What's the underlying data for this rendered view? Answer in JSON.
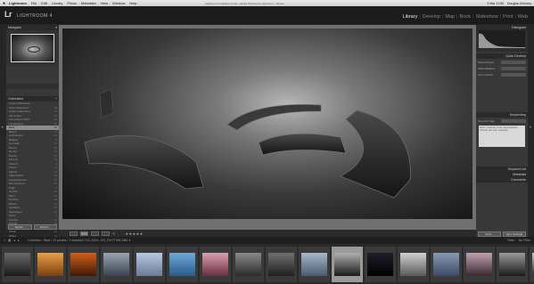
{
  "menubar": {
    "apple": "",
    "items": [
      "Lightroom",
      "File",
      "Edit",
      "Library",
      "Photo",
      "Metadata",
      "View",
      "Window",
      "Help"
    ],
    "window_title": "Lightroom 4 Catalog 4.lrcat - Adobe Photoshop Lightroom - Library",
    "status": [
      "5 Mar 11:55",
      "Douglas Chrinery"
    ]
  },
  "identity": {
    "logo": "Lr",
    "name": "LIGHTROOM 4"
  },
  "modules": [
    "Library",
    "Develop",
    "Map",
    "Book",
    "Slideshow",
    "Print",
    "Web"
  ],
  "active_module": "Library",
  "left_panel": {
    "navigator_label": "Navigator",
    "collections_label": "Collections",
    "collections": [
      {
        "name": "Smart Collections",
        "count": ""
      },
      {
        "name": "Client Selections",
        "count": "18"
      },
      {
        "name": "Colour Collections",
        "count": "24"
      },
      {
        "name": "Jan to Dec",
        "count": "32"
      },
      {
        "name": "LR Lessons 2012",
        "count": "16"
      },
      {
        "name": "Landscapes",
        "count": "45"
      },
      {
        "name": "Best",
        "count": "22"
      },
      {
        "name": "Beach",
        "count": "14"
      },
      {
        "name": "Architecture",
        "count": "31"
      },
      {
        "name": "Bridges",
        "count": "9"
      },
      {
        "name": "Cornwall",
        "count": "27"
      },
      {
        "name": "Devon",
        "count": "12"
      },
      {
        "name": "Dorset",
        "count": "19"
      },
      {
        "name": "Family",
        "count": "40"
      },
      {
        "name": "Fine Art",
        "count": "33"
      },
      {
        "name": "Flowers",
        "count": "8"
      },
      {
        "name": "Forest",
        "count": "11"
      },
      {
        "name": "Ireland",
        "count": "17"
      },
      {
        "name": "Lake District",
        "count": "23"
      },
      {
        "name": "Long Exposure",
        "count": "52"
      },
      {
        "name": "Monochrome",
        "count": "38"
      },
      {
        "name": "Night",
        "count": "6"
      },
      {
        "name": "Norfolk",
        "count": "15"
      },
      {
        "name": "Piers",
        "count": "21"
      },
      {
        "name": "Portfolio",
        "count": "28"
      },
      {
        "name": "Rivers",
        "count": "10"
      },
      {
        "name": "Scotland",
        "count": "26"
      },
      {
        "name": "Seascapes",
        "count": "44"
      },
      {
        "name": "Snow",
        "count": "7"
      },
      {
        "name": "Sunrise",
        "count": "13"
      },
      {
        "name": "Sunset",
        "count": "20"
      },
      {
        "name": "Trees",
        "count": "9"
      },
      {
        "name": "Urban",
        "count": "16"
      },
      {
        "name": "Wales",
        "count": "12"
      }
    ],
    "selected_index": 6,
    "import_label": "Import...",
    "export_label": "Export..."
  },
  "toolbar": {
    "stars": "★★★★★"
  },
  "right_panel": {
    "histogram_label": "Histogram",
    "quick_develop_label": "Quick Develop",
    "saved_preset": "Saved Preset",
    "white_balance": "White Balance",
    "tone_control": "Tone Control",
    "keywording_label": "Keywording",
    "keyword_tags": "Keyword Tags",
    "keywords_text": "bench, concrete, curve, long exposure, minimal, pier, sea, seascape",
    "keyword_list_label": "Keyword List",
    "metadata_label": "Metadata",
    "comments_label": "Comments",
    "sync_label": "Sync...",
    "sync_settings_label": "Sync Settings"
  },
  "filmbar": {
    "page": "1",
    "path": "Collection : Best  /  22 photos / 1 selected / DC-2024...RG_RHYTHM-ANK ▾",
    "filter_label": "Filter :",
    "filter_value": "No Filter"
  },
  "filmstrip": {
    "count": 17,
    "selected_index": 10
  }
}
